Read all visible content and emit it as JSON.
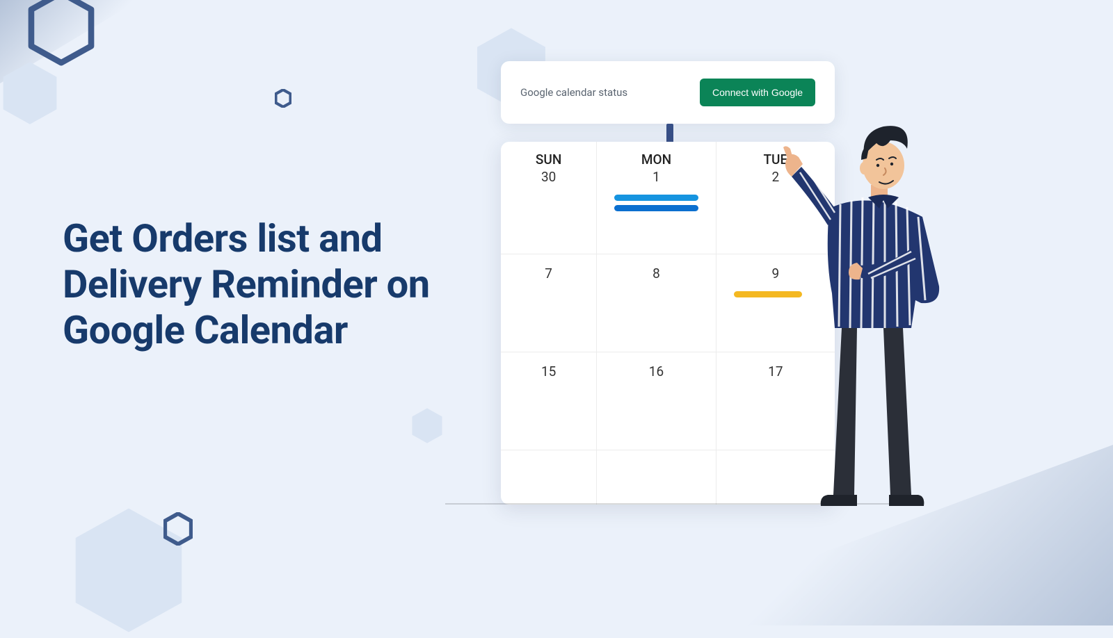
{
  "headline": "Get Orders list and Delivery Reminder on Google Calendar",
  "status": {
    "label": "Google calendar status",
    "cta": "Connect with Google"
  },
  "calendar": {
    "days": [
      "SUN",
      "MON",
      "TUE"
    ],
    "row1": [
      "30",
      "1",
      "2"
    ],
    "row2": [
      "7",
      "8",
      "9"
    ],
    "row3": [
      "15",
      "16",
      "17"
    ]
  }
}
